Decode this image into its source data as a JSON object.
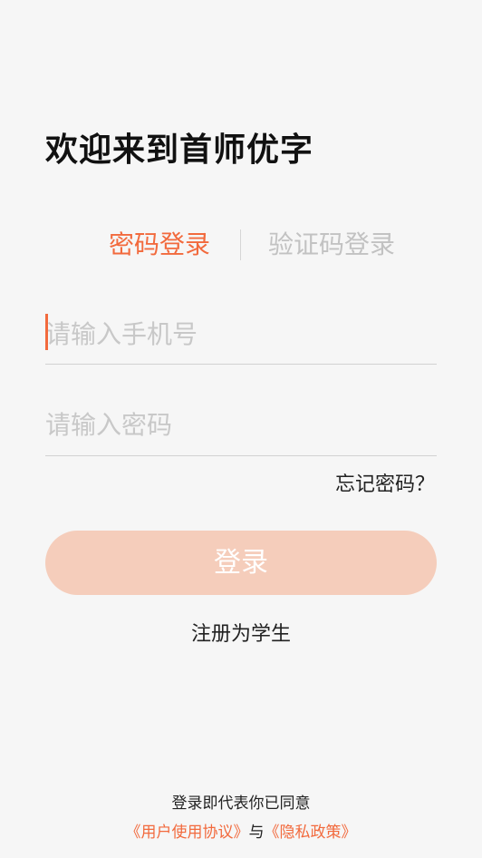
{
  "welcome": {
    "title": "欢迎来到首师优字"
  },
  "tabs": {
    "password_login": "密码登录",
    "code_login": "验证码登录",
    "active": "password_login"
  },
  "form": {
    "phone_placeholder": "请输入手机号",
    "phone_value": "",
    "password_placeholder": "请输入密码",
    "password_value": "",
    "forgot_password": "忘记密码？"
  },
  "actions": {
    "login_label": "登录",
    "register_label": "注册为学生"
  },
  "agreement": {
    "prefix": "登录即代表你已同意",
    "user_agreement": "《用户使用协议》",
    "conjunction": "与",
    "privacy_policy": "《隐私政策》"
  },
  "colors": {
    "accent": "#f26a3d",
    "button_disabled": "#f5cdbb",
    "inactive_tab": "#c2c2c2",
    "background": "#f6f6f6"
  }
}
